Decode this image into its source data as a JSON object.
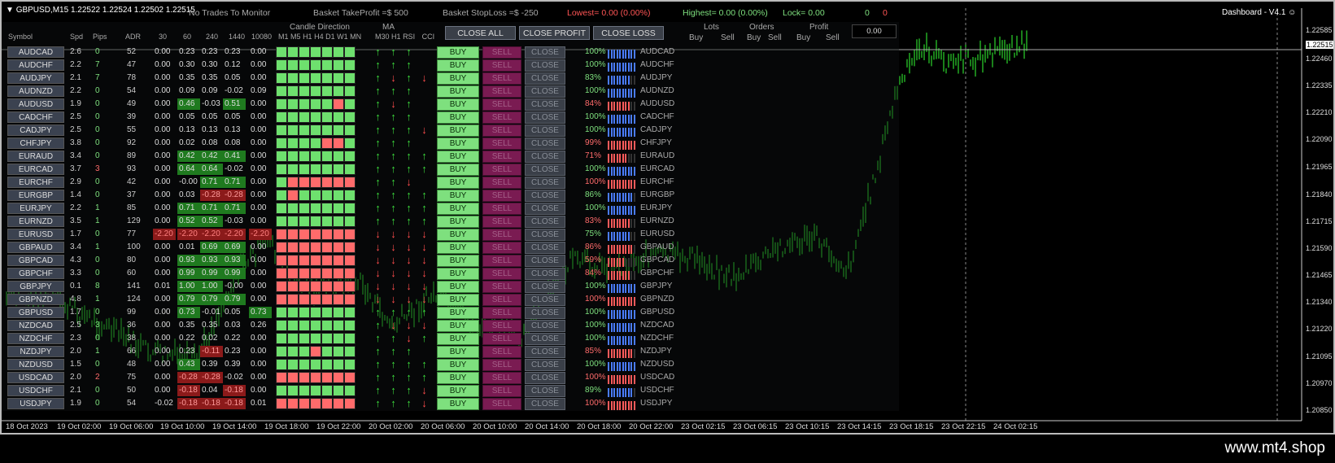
{
  "window": {
    "title": "GBPUSD,M15",
    "prices": "1.22522 1.22524 1.22502 1.22515",
    "dashboard_label": "Dashboard - V4.1"
  },
  "topbar": {
    "no_trades": "No Trades To Monitor",
    "basket_tp": "Basket TakeProfit =$ 500",
    "basket_sl": "Basket StopLoss =$ -250",
    "lowest": "Lowest= 0.00 (0.00%)",
    "highest": "Highest= 0.00 (0.00%)",
    "lock": "Lock= 0.00",
    "count_green": "0",
    "count_red": "0"
  },
  "headers": {
    "symbol": "Symbol",
    "spd": "Spd",
    "pips": "Pips",
    "adr": "ADR",
    "p30": "30",
    "p60": "60",
    "p240": "240",
    "p1440": "1440",
    "p10080": "10080",
    "candle_direction": "Candle Direction",
    "ma": "MA",
    "tf": [
      "M1",
      "M5",
      "H1",
      "H4",
      "D1",
      "W1",
      "MN"
    ],
    "ma_tf": [
      "M30",
      "H1"
    ],
    "rsi": "RSI",
    "cci": "CCI",
    "lots": "Lots",
    "orders": "Orders",
    "profit": "Profit",
    "buy": "Buy",
    "sell": "Sell"
  },
  "buttons": {
    "close_all": "CLOSE ALL",
    "close_profit": "CLOSE PROFIT",
    "close_loss": "CLOSE LOSS",
    "profit_value": "0.00",
    "row_buy": "BUY",
    "row_sell": "SELL",
    "row_close": "CLOSE"
  },
  "colors": {
    "green": "#7ee07e",
    "red": "#ff6b6b",
    "dkgreen": "#1f7a1f",
    "dkred": "#8b1a1a",
    "blue": "#4a7cff"
  },
  "rows": [
    {
      "sym": "AUDCAD",
      "spd": "2.6",
      "pips": "0",
      "adr": "52",
      "v": [
        "0.00",
        "0.23",
        "0.23",
        "0.23",
        "0.00"
      ],
      "cd": "gggggggg",
      "ma": "uuu ",
      "pct": "100%",
      "pc": "g"
    },
    {
      "sym": "AUDCHF",
      "spd": "2.2",
      "pips": "7",
      "adr": "47",
      "v": [
        "0.00",
        "0.30",
        "0.30",
        "0.12",
        "0.00"
      ],
      "cd": "gggggggg",
      "ma": "uuu ",
      "pct": "100%",
      "pc": "g"
    },
    {
      "sym": "AUDJPY",
      "spd": "2.1",
      "pips": "7",
      "adr": "78",
      "v": [
        "0.00",
        "0.35",
        "0.35",
        "0.05",
        "0.00"
      ],
      "cd": "gggggggg",
      "ma": "udud",
      "pct": "83%",
      "pc": "g"
    },
    {
      "sym": "AUDNZD",
      "spd": "2.2",
      "pips": "0",
      "adr": "54",
      "v": [
        "0.00",
        "0.09",
        "0.09",
        "-0.02",
        "0.09"
      ],
      "cd": "gggggggg",
      "ma": "uuu ",
      "pct": "100%",
      "pc": "g"
    },
    {
      "sym": "AUDUSD",
      "spd": "1.9",
      "pips": "0",
      "adr": "49",
      "v": [
        "0.00",
        "0.46",
        "-0.03",
        "0.51",
        "0.00"
      ],
      "cd": "gggggrgg",
      "ma": "udu ",
      "pct": "84%",
      "pc": "r"
    },
    {
      "sym": "CADCHF",
      "spd": "2.5",
      "pips": "0",
      "adr": "39",
      "v": [
        "0.00",
        "0.05",
        "0.05",
        "0.05",
        "0.00"
      ],
      "cd": "gggggggg",
      "ma": "uuu ",
      "pct": "100%",
      "pc": "g"
    },
    {
      "sym": "CADJPY",
      "spd": "2.5",
      "pips": "0",
      "adr": "55",
      "v": [
        "0.00",
        "0.13",
        "0.13",
        "0.13",
        "0.00"
      ],
      "cd": "gggggggg",
      "ma": "uuud",
      "pct": "100%",
      "pc": "g"
    },
    {
      "sym": "CHFJPY",
      "spd": "3.8",
      "pips": "0",
      "adr": "92",
      "v": [
        "0.00",
        "0.02",
        "0.08",
        "0.08",
        "0.00"
      ],
      "cd": "ggggrrgg",
      "ma": "uuu ",
      "pct": "99%",
      "pc": "r"
    },
    {
      "sym": "EURAUD",
      "spd": "3.4",
      "pips": "0",
      "adr": "89",
      "v": [
        "0.00",
        "0.42",
        "0.42",
        "0.41",
        "0.00"
      ],
      "cd": "gggggggg",
      "ma": "uuuu",
      "pct": "71%",
      "pc": "r"
    },
    {
      "sym": "EURCAD",
      "spd": "3.7",
      "pips": "3",
      "adr": "93",
      "v": [
        "0.00",
        "0.64",
        "0.64",
        "-0.02",
        "0.00"
      ],
      "cd": "gggggggg",
      "ma": "uuuu",
      "pct": "100%",
      "pc": "g"
    },
    {
      "sym": "EURCHF",
      "spd": "2.9",
      "pips": "0",
      "adr": "42",
      "v": [
        "0.00",
        "-0.00",
        "0.71",
        "0.71",
        "0.00"
      ],
      "cd": "grrrrrrr",
      "ma": "uud ",
      "pct": "100%",
      "pc": "r"
    },
    {
      "sym": "EURGBP",
      "spd": "1.4",
      "pips": "0",
      "adr": "37",
      "v": [
        "0.00",
        "0.03",
        "-0.28",
        "-0.28",
        "0.00"
      ],
      "cd": "grgggggg",
      "ma": "uuuu",
      "pct": "86%",
      "pc": "g"
    },
    {
      "sym": "EURJPY",
      "spd": "2.2",
      "pips": "1",
      "adr": "85",
      "v": [
        "0.00",
        "0.71",
        "0.71",
        "0.71",
        "0.00"
      ],
      "cd": "gggggggg",
      "ma": "uuuu",
      "pct": "100%",
      "pc": "g"
    },
    {
      "sym": "EURNZD",
      "spd": "3.5",
      "pips": "1",
      "adr": "129",
      "v": [
        "0.00",
        "0.52",
        "0.52",
        "-0.03",
        "0.00"
      ],
      "cd": "gggggggg",
      "ma": "uuuu",
      "pct": "83%",
      "pc": "r"
    },
    {
      "sym": "EURUSD",
      "spd": "1.7",
      "pips": "0",
      "adr": "77",
      "v": [
        "-2.20",
        "-2.20",
        "-2.20",
        "-2.20",
        "-2.20"
      ],
      "cd": "rrrrrrrr",
      "ma": "dddd",
      "pct": "75%",
      "pc": "g"
    },
    {
      "sym": "GBPAUD",
      "spd": "3.4",
      "pips": "1",
      "adr": "100",
      "v": [
        "0.00",
        "0.01",
        "0.69",
        "0.69",
        "0.00"
      ],
      "cd": "rrrrrrrr",
      "ma": "dddd",
      "pct": "86%",
      "pc": "r"
    },
    {
      "sym": "GBPCAD",
      "spd": "4.3",
      "pips": "0",
      "adr": "80",
      "v": [
        "0.00",
        "0.93",
        "0.93",
        "0.93",
        "0.00"
      ],
      "cd": "rrrrrrrr",
      "ma": "dddd",
      "pct": "59%",
      "pc": "r"
    },
    {
      "sym": "GBPCHF",
      "spd": "3.3",
      "pips": "0",
      "adr": "60",
      "v": [
        "0.00",
        "0.99",
        "0.99",
        "0.99",
        "0.00"
      ],
      "cd": "rrrrrrrr",
      "ma": "dddd",
      "pct": "84%",
      "pc": "r"
    },
    {
      "sym": "GBPJPY",
      "spd": "0.1",
      "pips": "8",
      "adr": "141",
      "v": [
        "0.01",
        "1.00",
        "1.00",
        "-0.00",
        "0.00"
      ],
      "cd": "rrrrrrrr",
      "ma": "dddd",
      "pct": "100%",
      "pc": "g"
    },
    {
      "sym": "GBPNZD",
      "spd": "4.8",
      "pips": "1",
      "adr": "124",
      "v": [
        "0.00",
        "0.79",
        "0.79",
        "0.79",
        "0.00"
      ],
      "cd": "rrrrrrrr",
      "ma": "dddd",
      "pct": "100%",
      "pc": "r"
    },
    {
      "sym": "GBPUSD",
      "spd": "1.7",
      "pips": "0",
      "adr": "99",
      "v": [
        "0.00",
        "0.73",
        "-0.01",
        "0.05",
        "0.73"
      ],
      "cd": "gggggggg",
      "ma": "uuuu",
      "pct": "100%",
      "pc": "g"
    },
    {
      "sym": "NZDCAD",
      "spd": "2.5",
      "pips": "3",
      "adr": "36",
      "v": [
        "0.00",
        "0.35",
        "0.35",
        "0.03",
        "0.26"
      ],
      "cd": "gggggggg",
      "ma": "uddd",
      "pct": "100%",
      "pc": "g"
    },
    {
      "sym": "NZDCHF",
      "spd": "2.3",
      "pips": "0",
      "adr": "38",
      "v": [
        "0.00",
        "0.22",
        "0.02",
        "0.22",
        "0.00"
      ],
      "cd": "gggggggg",
      "ma": "uudu",
      "pct": "100%",
      "pc": "g"
    },
    {
      "sym": "NZDJPY",
      "spd": "2.0",
      "pips": "1",
      "adr": "66",
      "v": [
        "0.00",
        "0.23",
        "-0.11",
        "0.23",
        "0.00"
      ],
      "cd": "gggrgggg",
      "ma": "uuu ",
      "pct": "85%",
      "pc": "r"
    },
    {
      "sym": "NZDUSD",
      "spd": "1.5",
      "pips": "0",
      "adr": "48",
      "v": [
        "0.00",
        "0.43",
        "0.39",
        "0.39",
        "0.00"
      ],
      "cd": "gggggggg",
      "ma": "uuuu",
      "pct": "100%",
      "pc": "g"
    },
    {
      "sym": "USDCAD",
      "spd": "2.0",
      "pips": "2",
      "adr": "75",
      "v": [
        "0.00",
        "-0.28",
        "-0.28",
        "-0.02",
        "0.00"
      ],
      "cd": "rrrrrrrr",
      "ma": "uuuu",
      "pct": "100%",
      "pc": "r"
    },
    {
      "sym": "USDCHF",
      "spd": "2.1",
      "pips": "0",
      "adr": "50",
      "v": [
        "0.00",
        "-0.18",
        "0.04",
        "-0.18",
        "0.00"
      ],
      "cd": "gggggggg",
      "ma": "uuud",
      "pct": "89%",
      "pc": "g"
    },
    {
      "sym": "USDJPY",
      "spd": "1.9",
      "pips": "0",
      "adr": "54",
      "v": [
        "-0.02",
        "-0.18",
        "-0.18",
        "-0.18",
        "0.01"
      ],
      "cd": "rrrrrrrr",
      "ma": "uuud",
      "pct": "100%",
      "pc": "r"
    }
  ],
  "price_axis": [
    "1.22585",
    "1.22515",
    "1.22460",
    "1.22335",
    "1.22210",
    "1.22090",
    "1.21965",
    "1.21840",
    "1.21715",
    "1.21590",
    "1.21465",
    "1.21340",
    "1.21220",
    "1.21095",
    "1.20970",
    "1.20850"
  ],
  "time_axis": [
    "18 Oct 2023",
    "19 Oct 02:00",
    "19 Oct 06:00",
    "19 Oct 10:00",
    "19 Oct 14:00",
    "19 Oct 18:00",
    "19 Oct 22:00",
    "20 Oct 02:00",
    "20 Oct 06:00",
    "20 Oct 10:00",
    "20 Oct 14:00",
    "20 Oct 18:00",
    "20 Oct 22:00",
    "23 Oct 02:15",
    "23 Oct 06:15",
    "23 Oct 10:15",
    "23 Oct 14:15",
    "23 Oct 18:15",
    "23 Oct 22:15",
    "24 Oct 02:15"
  ],
  "current_price": "1.22515",
  "watermark": "www.mt4.shop"
}
